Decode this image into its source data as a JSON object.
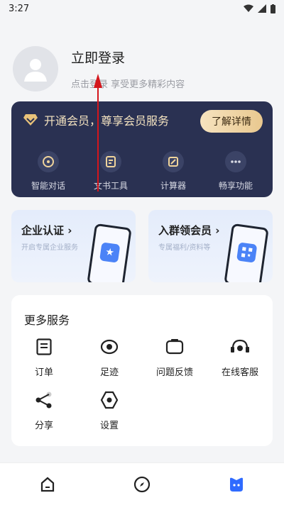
{
  "status_bar": {
    "time": "3:27"
  },
  "profile": {
    "title": "立即登录",
    "subtitle": "点击登录 享受更多精彩内容"
  },
  "vip": {
    "title": "开通会员，尊享会员服务",
    "button": "了解详情",
    "items": [
      {
        "label": "智能对话",
        "icon": "chat-icon"
      },
      {
        "label": "文书工具",
        "icon": "document-icon"
      },
      {
        "label": "计算器",
        "icon": "calculator-icon"
      },
      {
        "label": "畅享功能",
        "icon": "more-icon"
      }
    ]
  },
  "promos": [
    {
      "title": "企业认证 ›",
      "subtitle": "开启专属企业服务"
    },
    {
      "title": "入群领会员 ›",
      "subtitle": "专属福利/资料等"
    }
  ],
  "services": {
    "title": "更多服务",
    "items": [
      {
        "label": "订单",
        "icon": "order-icon"
      },
      {
        "label": "足迹",
        "icon": "footprint-icon"
      },
      {
        "label": "问题反馈",
        "icon": "feedback-icon"
      },
      {
        "label": "在线客服",
        "icon": "headset-icon"
      },
      {
        "label": "分享",
        "icon": "share-icon"
      },
      {
        "label": "设置",
        "icon": "settings-icon"
      }
    ]
  },
  "nav": [
    {
      "icon": "home-icon"
    },
    {
      "icon": "compass-icon"
    },
    {
      "icon": "profile-icon",
      "active_color": "#2f6bff"
    }
  ],
  "colors": {
    "accent": "#2f6bff",
    "vip_bg": "#2a3152",
    "annotation": "#d4161c"
  }
}
